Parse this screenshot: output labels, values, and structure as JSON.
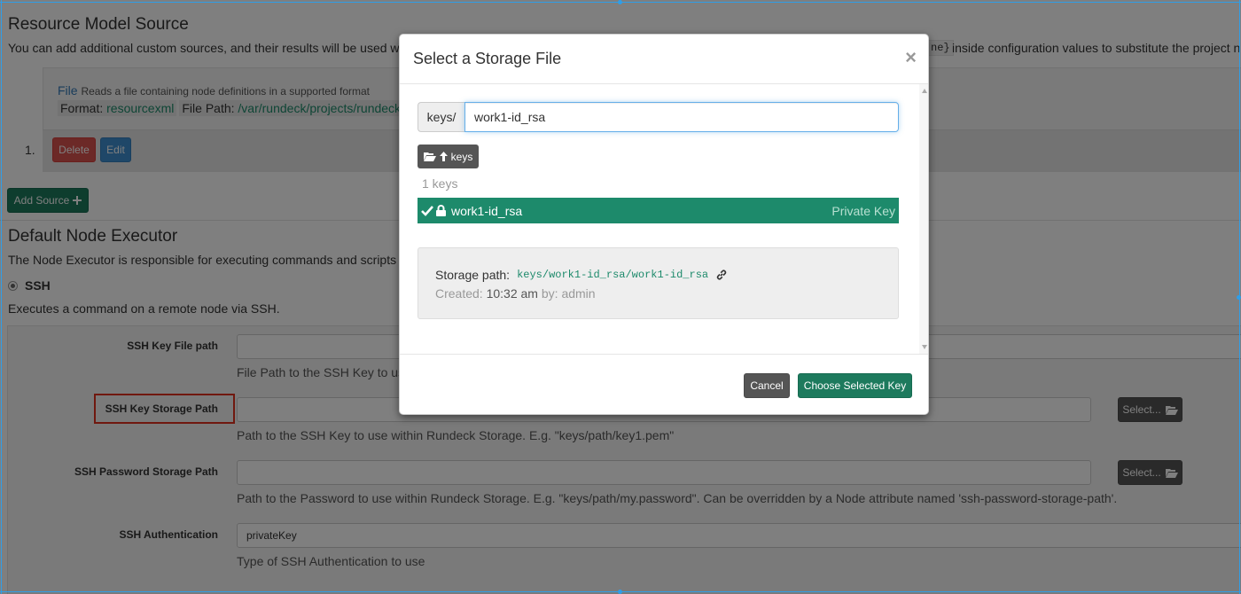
{
  "background": {
    "resource_section": {
      "title": "Resource Model Source",
      "description": "You can add additional custom sources, and their results will be used w",
      "description_tail": "inside configuration values to substitute the project n",
      "code_snippet": "ne}"
    },
    "source": {
      "file_link": "File",
      "file_desc": "Reads a file containing node definitions in a supported format",
      "format_label": "Format:",
      "format_value": "resourcexml",
      "path_label": "File Path:",
      "path_value": "/var/rundeck/projects/rundeck",
      "index": "1.",
      "delete_label": "Delete",
      "edit_label": "Edit"
    },
    "add_source_label": "Add Source",
    "executor_section": {
      "title": "Default Node Executor",
      "description": "The Node Executor is responsible for executing commands and scripts",
      "option_label": "SSH",
      "option_description": "Executes a command on a remote node via SSH."
    },
    "fields": {
      "key_file_label": "SSH Key File path",
      "key_file_help": "File Path to the SSH Key to us",
      "key_storage_label": "SSH Key Storage Path",
      "key_storage_help": "Path to the SSH Key to use within Rundeck Storage. E.g. \"keys/path/key1.pem\"",
      "password_storage_label": "SSH Password Storage Path",
      "password_storage_help": "Path to the Password to use within Rundeck Storage. E.g. \"keys/path/my.password\". Can be overridden by a Node attribute named 'ssh-password-storage-path'.",
      "auth_label": "SSH Authentication",
      "auth_value": "privateKey",
      "auth_help": "Type of SSH Authentication to use",
      "select_label": "Select..."
    }
  },
  "modal": {
    "title": "Select a Storage File",
    "close_symbol": "×",
    "path_prefix": "keys/",
    "path_value": "work1-id_rsa",
    "up_button_label": "keys",
    "keys_count": "1 keys",
    "key_row": {
      "name": "work1-id_rsa",
      "type": "Private Key"
    },
    "details": {
      "storage_path_label": "Storage path:",
      "storage_path_value": "keys/work1-id_rsa/work1-id_rsa",
      "created_label": "Created:",
      "created_time": "10:32 am",
      "by_label": "by:",
      "by_user": "admin"
    },
    "cancel_label": "Cancel",
    "choose_label": "Choose Selected Key"
  },
  "colors": {
    "accent_green": "#1d8a6b",
    "danger": "#d9534f",
    "info": "#3f8fd0",
    "highlight": "#e0301e",
    "frame": "#2f9ee8"
  },
  "icons": [
    "close-icon",
    "folder-open-icon",
    "arrow-up-icon",
    "check-icon",
    "lock-icon",
    "link-icon",
    "plus-icon"
  ]
}
